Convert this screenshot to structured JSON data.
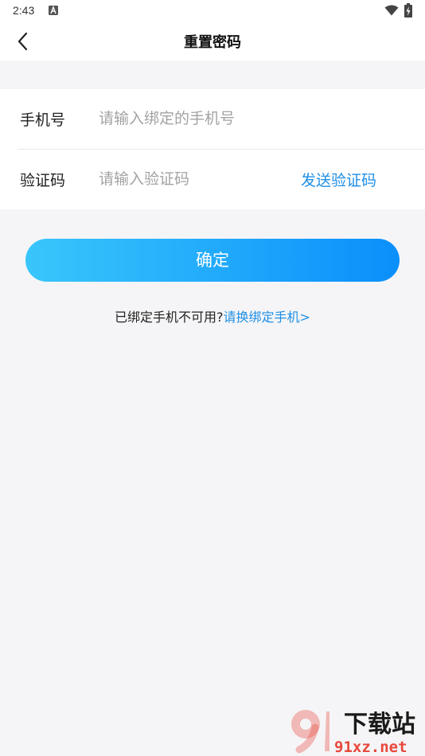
{
  "status_bar": {
    "time": "2:43",
    "notification_icon": "a-letter-icon",
    "wifi_icon": "wifi-icon",
    "battery_icon": "battery-charging-icon"
  },
  "nav": {
    "back_icon": "chevron-left-icon",
    "title": "重置密码"
  },
  "form": {
    "phone_label": "手机号",
    "phone_placeholder": "请输入绑定的手机号",
    "phone_value": "",
    "code_label": "验证码",
    "code_placeholder": "请输入验证码",
    "code_value": "",
    "send_code": "发送验证码"
  },
  "confirm_button": "确定",
  "tip": {
    "text": "已绑定手机不可用?",
    "link": "请换绑定手机>"
  },
  "watermark": {
    "brand_text": "下载站",
    "site": "91xz.net",
    "logo_number": "91"
  },
  "colors": {
    "accent": "#1f8fe6",
    "button_gradient_start": "#39c6fb",
    "button_gradient_end": "#0a8ffb",
    "page_background": "#f5f5f7",
    "watermark_red": "#e8483c"
  }
}
